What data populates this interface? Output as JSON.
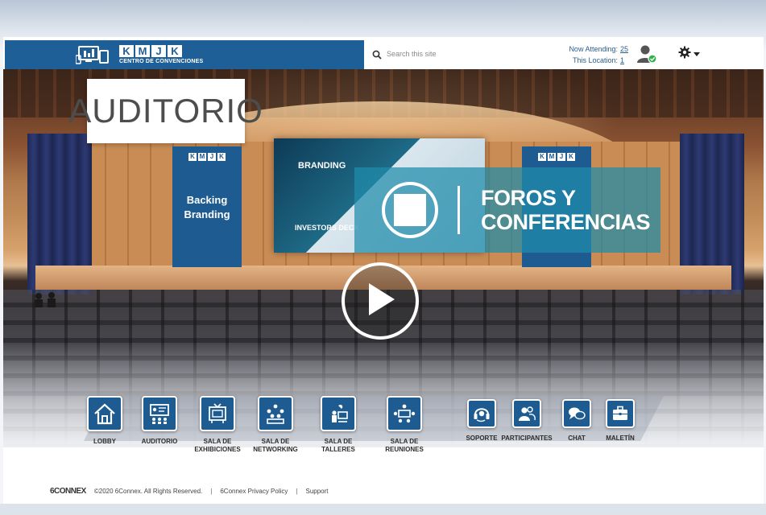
{
  "header": {
    "brand_letters": [
      "K",
      "M",
      "J",
      "K"
    ],
    "brand_subtitle": "CENTRO DE CONVENCIONES",
    "search_placeholder": "Search this site",
    "now_attending_label": "Now Attending:",
    "now_attending_value": "25",
    "this_location_label": "This Location:",
    "this_location_value": "1",
    "icons": [
      "monitor-devices-icon",
      "search-icon",
      "user-online-icon",
      "gear-icon",
      "caret-down-icon"
    ]
  },
  "stage": {
    "title": "AUDITORIO",
    "banner_left": {
      "letters": [
        "K",
        "M",
        "J",
        "K"
      ],
      "line1": "Backing",
      "line2": "Branding"
    },
    "banner_right": {
      "letters": [
        "K",
        "M",
        "J",
        "K"
      ]
    },
    "screen": {
      "headline": "BRANDING",
      "footer": "INVESTORS DECK"
    },
    "overlay": {
      "line1": "FOROS Y",
      "line2": "CONFERENCIAS"
    },
    "play_icon": "play-icon"
  },
  "nav": {
    "items": [
      {
        "label": "LOBBY",
        "icon": "house-icon"
      },
      {
        "label": "AUDITORIO",
        "icon": "presentation-icon"
      },
      {
        "label": "SALA DE\nEXHIBICIONES",
        "icon": "exhibition-icon"
      },
      {
        "label": "SALA DE\nNETWORKING",
        "icon": "networking-icon"
      },
      {
        "label": "SALA DE\nTALLERES",
        "icon": "workshop-icon"
      },
      {
        "label": "SALA DE\nREUNIONES",
        "icon": "meeting-icon"
      },
      {
        "label": "SOPORTE",
        "icon": "headset-icon"
      },
      {
        "label": "PARTICIPANTES",
        "icon": "participants-icon"
      },
      {
        "label": "CHAT",
        "icon": "chat-icon"
      },
      {
        "label": "MALETÍN",
        "icon": "briefcase-icon"
      }
    ]
  },
  "footer": {
    "logo": "6CONNEX",
    "copyright": "©2020 6Connex. All Rights Reserved.",
    "privacy": "6Connex Privacy Policy",
    "support": "Support",
    "separator": "|"
  },
  "colors": {
    "brand_blue": "#1f5f97",
    "overlay_teal": "#1e8caa",
    "title_text": "#4d4d4d",
    "attend_text": "#2a5d8f"
  }
}
